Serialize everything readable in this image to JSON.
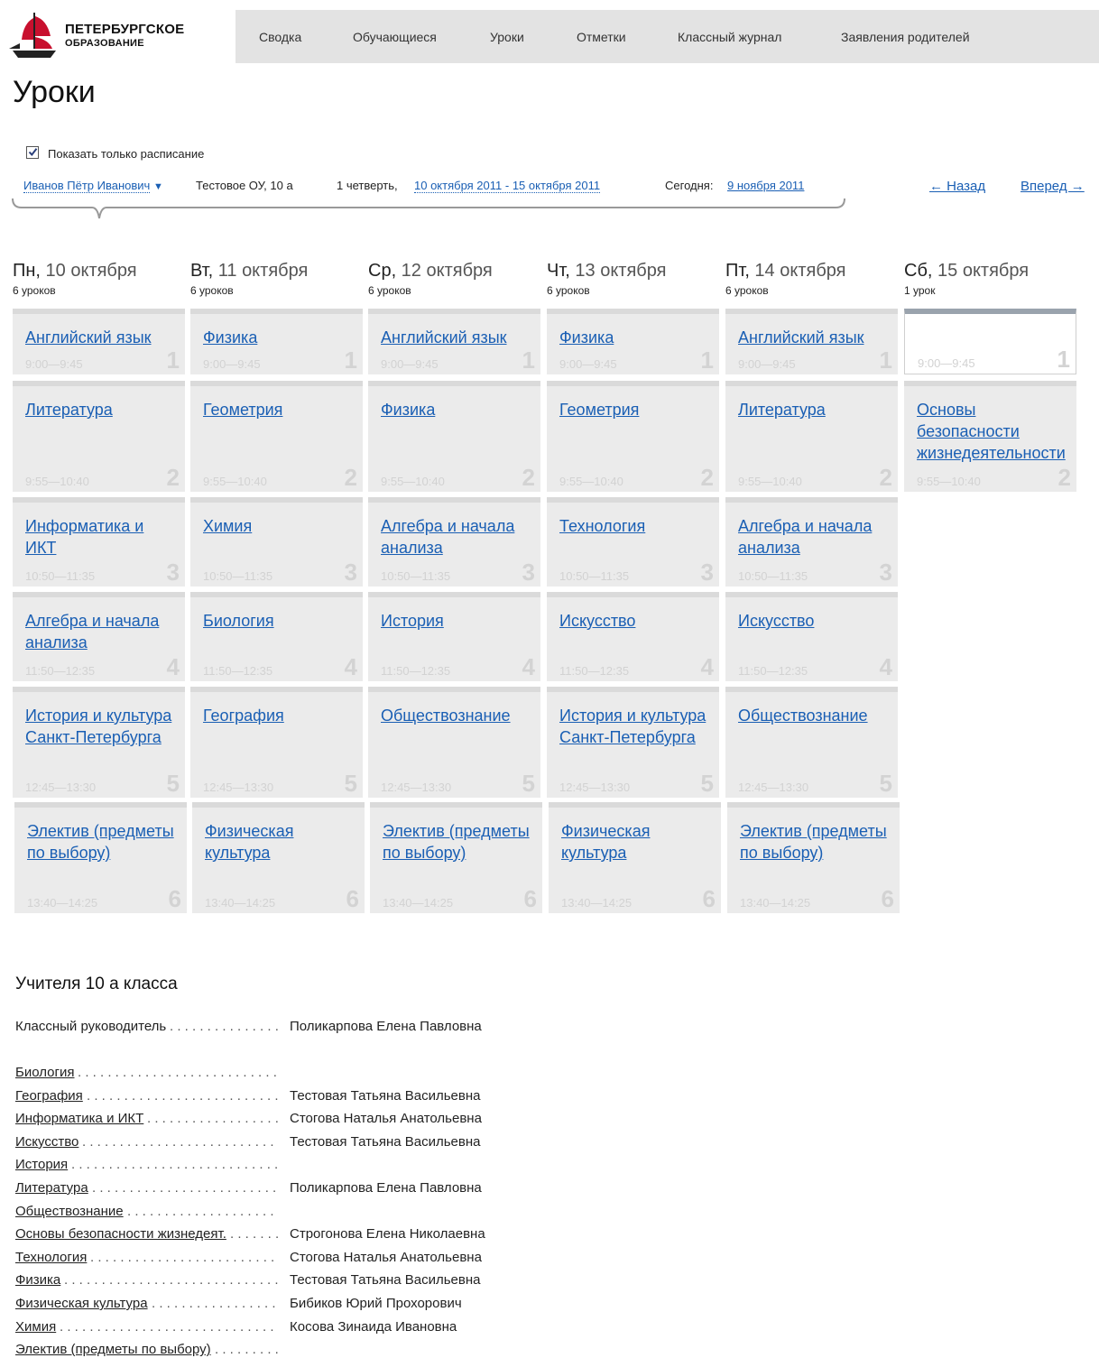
{
  "header": {
    "logo_line1": "ПЕТЕРБУРГСКОЕ",
    "logo_line2": "ОБРАЗОВАНИЕ",
    "nav": [
      "Сводка",
      "Обучающиеся",
      "Уроки",
      "Отметки",
      "Классный журнал",
      "Заявления родителей"
    ]
  },
  "page_title": "Уроки",
  "filter": {
    "checkbox_label": "Показать только расписание",
    "checked": true,
    "person": "Иванов Пётр Иванович",
    "school_class": "Тестовое ОУ, 10 а",
    "quarter": "1 четверть,",
    "period": "10 октября 2011 - 15 октября 2011",
    "today_label": "Сегодня:",
    "today": "9 ноября 2011",
    "back": "← Назад",
    "forward": "Вперед →"
  },
  "days": [
    {
      "name": "Пн,",
      "date": "10 октября",
      "count": "6 уроков"
    },
    {
      "name": "Вт,",
      "date": "11 октября",
      "count": "6 уроков"
    },
    {
      "name": "Ср,",
      "date": "12 октября",
      "count": "6 уроков"
    },
    {
      "name": "Чт,",
      "date": "13 октября",
      "count": "6 уроков"
    },
    {
      "name": "Пт,",
      "date": "14 октября",
      "count": "6 уроков"
    },
    {
      "name": "Сб,",
      "date": "15 октября",
      "count": "1 урок"
    }
  ],
  "times": [
    "9:00—9:45",
    "9:55—10:40",
    "10:50—11:35",
    "11:50—12:35",
    "12:45—13:30",
    "13:40—14:25"
  ],
  "lesson_numbers": [
    "1",
    "2",
    "3",
    "4",
    "5",
    "6"
  ],
  "schedule": [
    [
      "Английский язык",
      "Литература",
      "Информатика и ИКТ",
      "Алгебра и начала анализа",
      "История и культура Санкт-Петербурга",
      "Электив (предметы по выбору)"
    ],
    [
      "Физика",
      "Геометрия",
      "Химия",
      "Биология",
      "География",
      "Физическая культура"
    ],
    [
      "Английский язык",
      "Физика",
      "Алгебра и начала анализа",
      "История",
      "Обществознание",
      "Электив (предметы по выбору)"
    ],
    [
      "Физика",
      "Геометрия",
      "Технология",
      "Искусство",
      "История и культура Санкт-Петербурга",
      "Физическая культура"
    ],
    [
      "Английский язык",
      "Литература",
      "Алгебра и начала анализа",
      "Искусство",
      "Обществознание",
      "Электив (предметы по выбору)"
    ],
    [
      "",
      "Основы безопасности жизнедеятельности"
    ]
  ],
  "teachers": {
    "title": "Учителя 10 а класса",
    "class_teacher_label": "Классный руководитель",
    "class_teacher": "Поликарпова Елена Павловна",
    "rows": [
      {
        "subject": "Биология",
        "teacher": ""
      },
      {
        "subject": "География",
        "teacher": "Тестовая Татьяна Васильевна"
      },
      {
        "subject": "Информатика и ИКТ",
        "teacher": "Стогова Наталья Анатольевна"
      },
      {
        "subject": "Искусство",
        "teacher": "Тестовая Татьяна Васильевна"
      },
      {
        "subject": "История",
        "teacher": ""
      },
      {
        "subject": "Литература",
        "teacher": "Поликарпова Елена Павловна"
      },
      {
        "subject": "Обществознание",
        "teacher": ""
      },
      {
        "subject": "Основы безопасности жизнедеят.",
        "teacher": "Строгонова Елена Николаевна"
      },
      {
        "subject": "Технология",
        "teacher": "Стогова Наталья Анатольевна"
      },
      {
        "subject": "Физика",
        "teacher": "Тестовая Татьяна Васильевна"
      },
      {
        "subject": "Физическая культура",
        "teacher": "Бибиков Юрий Прохорович"
      },
      {
        "subject": "Химия",
        "teacher": "Косова Зинаида Ивановна"
      },
      {
        "subject": "Электив (предметы по выбору)",
        "teacher": ""
      }
    ]
  }
}
